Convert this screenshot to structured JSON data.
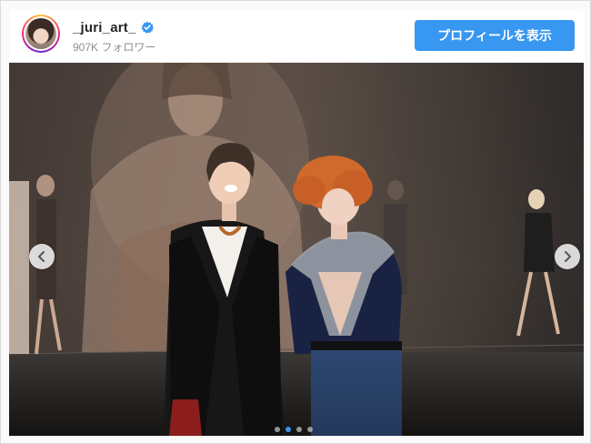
{
  "post": {
    "username": "_juri_art_",
    "followers": "907K フォロワー",
    "profile_button": "プロフィールを表示",
    "verified": true
  },
  "carousel": {
    "slide_count": 4,
    "active_index": 1
  },
  "icons": {
    "verified": "verified-badge-icon",
    "prev": "chevron-left-icon",
    "next": "chevron-right-icon"
  },
  "colors": {
    "accent": "#3897f0",
    "username": "#262626",
    "secondary_text": "#8e8e8e"
  }
}
